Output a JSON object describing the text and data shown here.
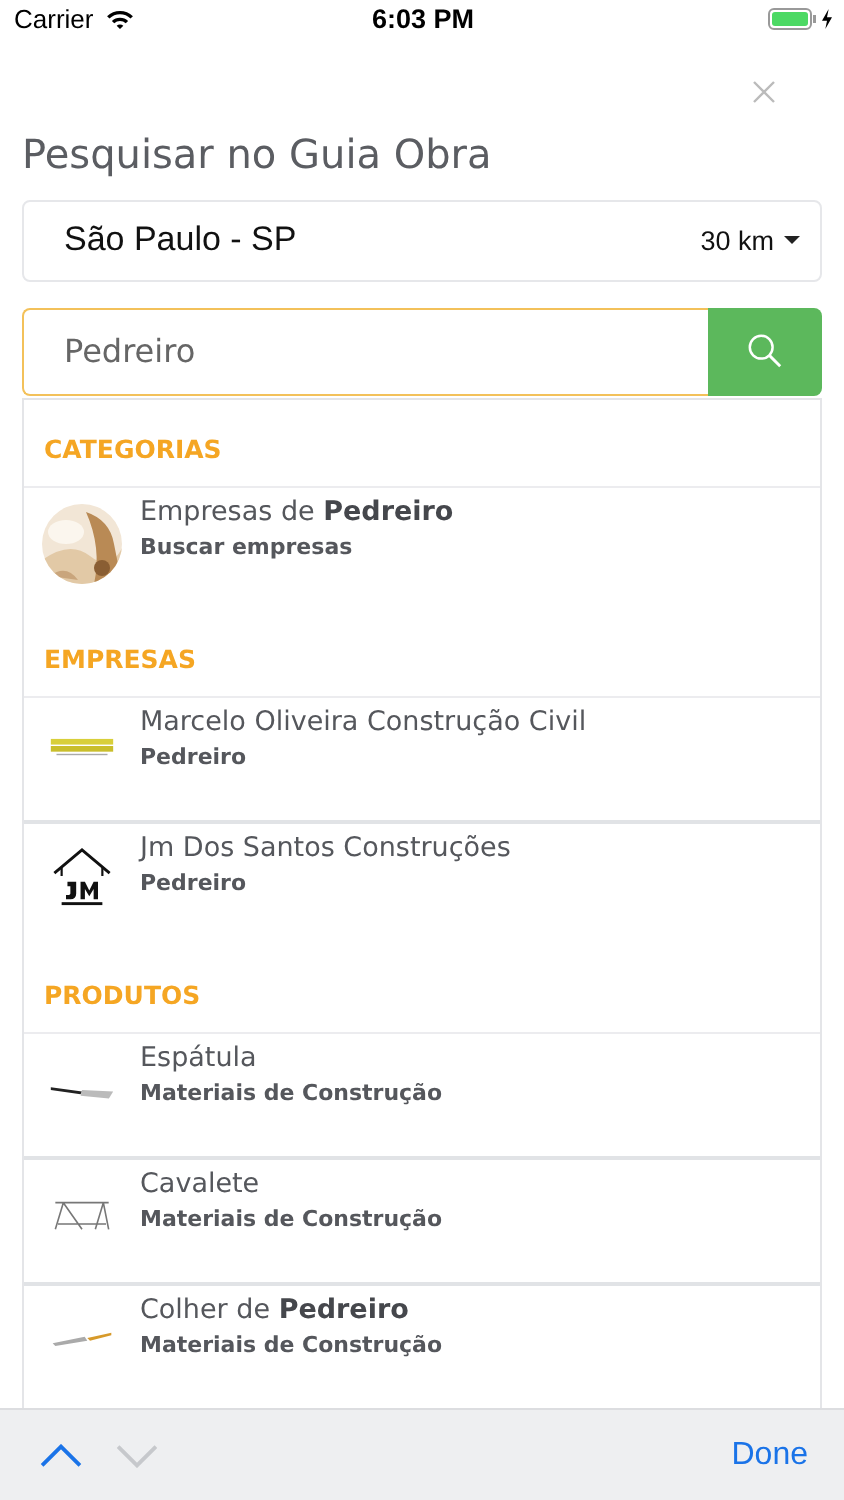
{
  "status_bar": {
    "carrier": "Carrier",
    "time": "6:03 PM",
    "charging": true
  },
  "title": "Pesquisar no Guia Obra",
  "location": {
    "city": "São Paulo - SP",
    "radius": "30 km"
  },
  "search": {
    "value": "Pedreiro"
  },
  "sections": [
    {
      "heading": "CATEGORIAS",
      "items": [
        {
          "kind": "picture",
          "title": "Empresas de **Pedreiro**",
          "subtitle": "Buscar empresas"
        }
      ]
    },
    {
      "heading": "EMPRESAS",
      "items": [
        {
          "kind": "banner-logo",
          "title": "Marcelo Oliveira Construção Civil",
          "subtitle": "Pedreiro"
        },
        {
          "kind": "house-logo",
          "title": "Jm Dos Santos Construções",
          "subtitle": "Pedreiro"
        }
      ]
    },
    {
      "heading": "PRODUTOS",
      "items": [
        {
          "kind": "spatula",
          "title": "Espátula",
          "subtitle": "Materiais de Construção"
        },
        {
          "kind": "trestle",
          "title": "Cavalete",
          "subtitle": "Materiais de Construção"
        },
        {
          "kind": "trowel",
          "title": "Colher de **Pedreiro**",
          "subtitle": "Materiais de Construção"
        }
      ]
    }
  ],
  "toolbar": {
    "previous": {
      "disabled": false
    },
    "next": {
      "disabled": true
    },
    "done": "Done"
  }
}
